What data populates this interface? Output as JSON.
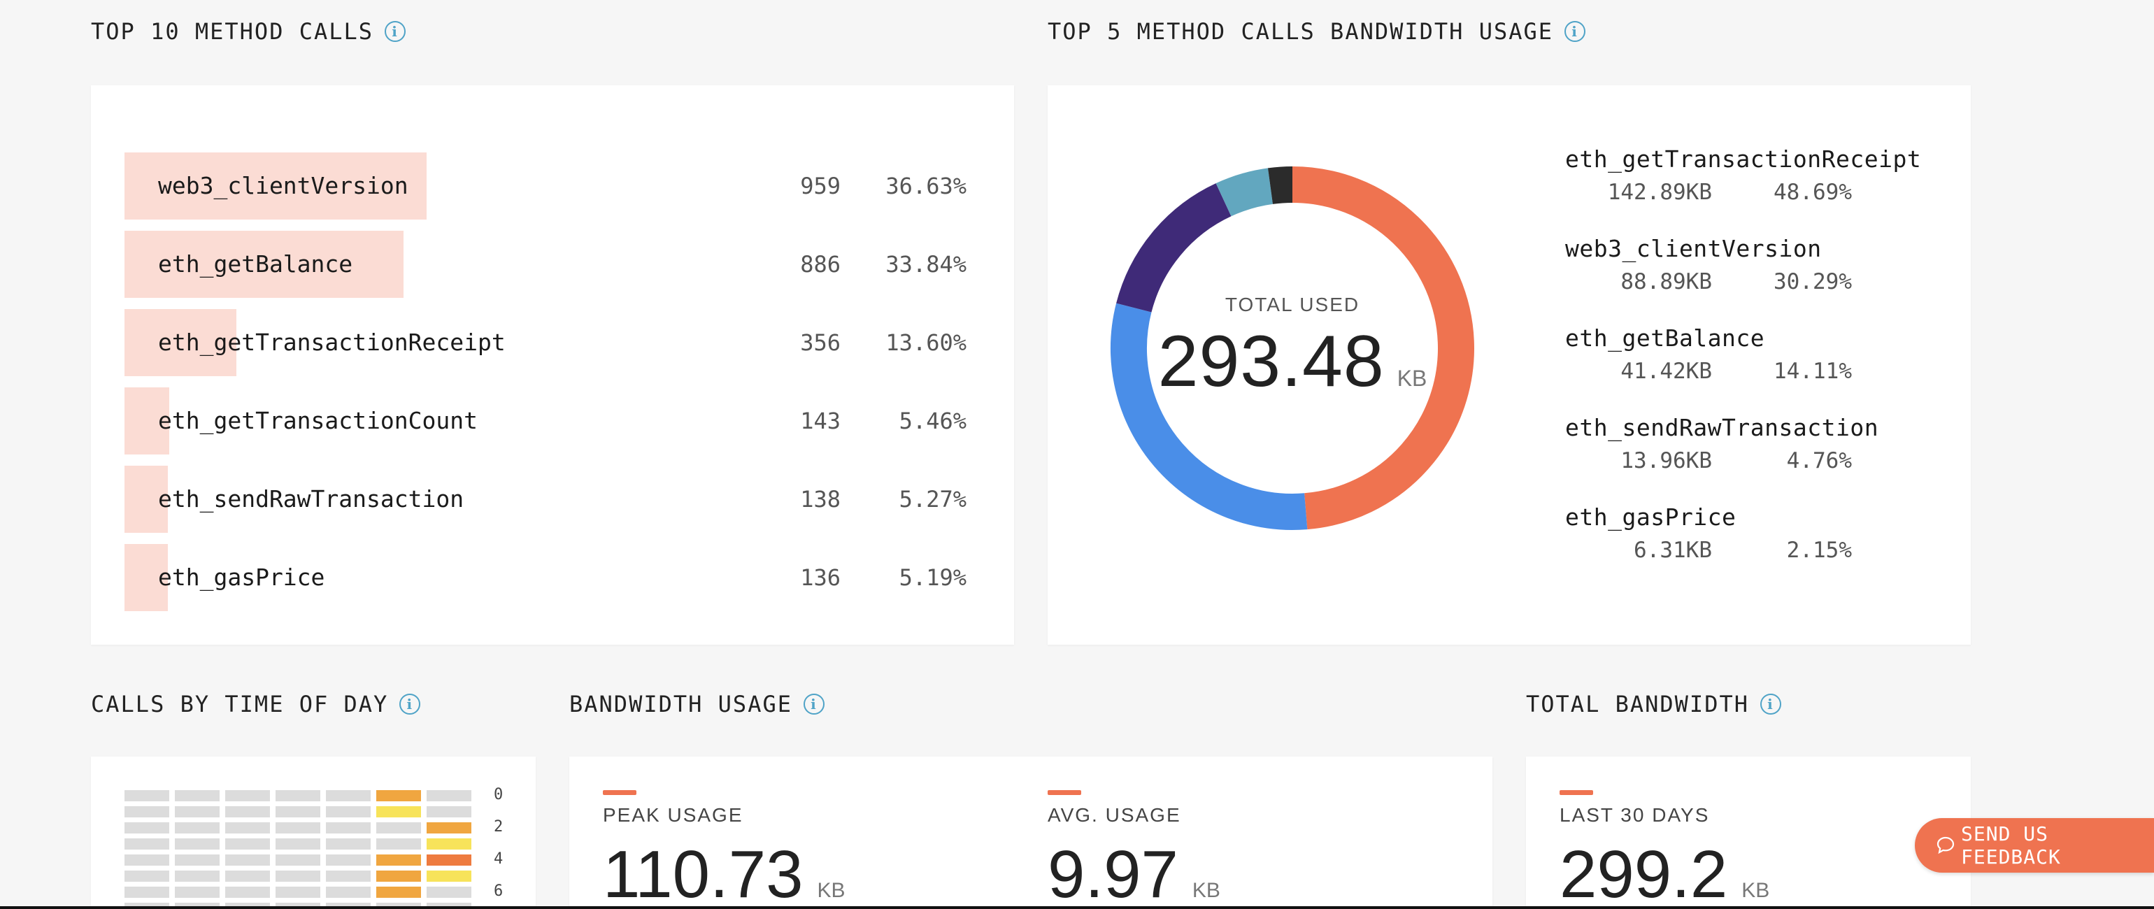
{
  "top_calls": {
    "title": "TOP 10 METHOD CALLS",
    "rows": [
      {
        "name": "web3_clientVersion",
        "count": "959",
        "pct": "36.63%",
        "share": 0.3663
      },
      {
        "name": "eth_getBalance",
        "count": "886",
        "pct": "33.84%",
        "share": 0.3384
      },
      {
        "name": "eth_getTransactionReceipt",
        "count": "356",
        "pct": "13.60%",
        "share": 0.136
      },
      {
        "name": "eth_getTransactionCount",
        "count": "143",
        "pct": "5.46%",
        "share": 0.0546
      },
      {
        "name": "eth_sendRawTransaction",
        "count": "138",
        "pct": "5.27%",
        "share": 0.0527
      },
      {
        "name": "eth_gasPrice",
        "count": "136",
        "pct": "5.19%",
        "share": 0.0519
      }
    ]
  },
  "bandwidth_top5": {
    "title": "TOP 5 METHOD CALLS BANDWIDTH USAGE",
    "total_label": "TOTAL USED",
    "total_value": "293.48",
    "total_unit": "KB",
    "items": [
      {
        "name": "eth_getTransactionReceipt",
        "size": "142.89KB",
        "pct": "48.69%",
        "share": 48.69,
        "color": "#ef7350"
      },
      {
        "name": "web3_clientVersion",
        "size": "88.89KB",
        "pct": "30.29%",
        "share": 30.29,
        "color": "#4a8ee8"
      },
      {
        "name": "eth_getBalance",
        "size": "41.42KB",
        "pct": "14.11%",
        "share": 14.11,
        "color": "#3f2a78"
      },
      {
        "name": "eth_sendRawTransaction",
        "size": "13.96KB",
        "pct": "4.76%",
        "share": 4.76,
        "color": "#62a7bf"
      },
      {
        "name": "eth_gasPrice",
        "size": "6.31KB",
        "pct": "2.15%",
        "share": 2.15,
        "color": "#2b2b2b"
      }
    ]
  },
  "calls_by_time": {
    "title": "CALLS BY TIME OF DAY",
    "hour_labels": [
      "0",
      "2",
      "4",
      "6"
    ],
    "highlights": [
      {
        "row": 0,
        "col": 5,
        "color": "#f0a640"
      },
      {
        "row": 1,
        "col": 5,
        "color": "#f7e35a"
      },
      {
        "row": 2,
        "col": 6,
        "color": "#f0a640"
      },
      {
        "row": 3,
        "col": 6,
        "color": "#f7e35a"
      },
      {
        "row": 4,
        "col": 5,
        "color": "#f0a640"
      },
      {
        "row": 4,
        "col": 6,
        "color": "#ee7b3f"
      },
      {
        "row": 5,
        "col": 5,
        "color": "#f0a640"
      },
      {
        "row": 5,
        "col": 6,
        "color": "#f7e35a"
      },
      {
        "row": 6,
        "col": 5,
        "color": "#f0a640"
      }
    ]
  },
  "bandwidth_usage": {
    "title": "BANDWIDTH USAGE",
    "peak_label": "PEAK USAGE",
    "peak_value": "110.73",
    "peak_unit": "KB",
    "avg_label": "AVG. USAGE",
    "avg_value": "9.97",
    "avg_unit": "KB"
  },
  "total_bandwidth": {
    "title": "TOTAL BANDWIDTH",
    "label": "LAST 30 DAYS",
    "value": "299.2",
    "unit": "KB"
  },
  "feedback": {
    "label": "SEND US FEEDBACK"
  },
  "colors": {
    "accent": "#ef7350",
    "info": "#4fa3c7",
    "bar_fill": "#fbdcd4"
  }
}
